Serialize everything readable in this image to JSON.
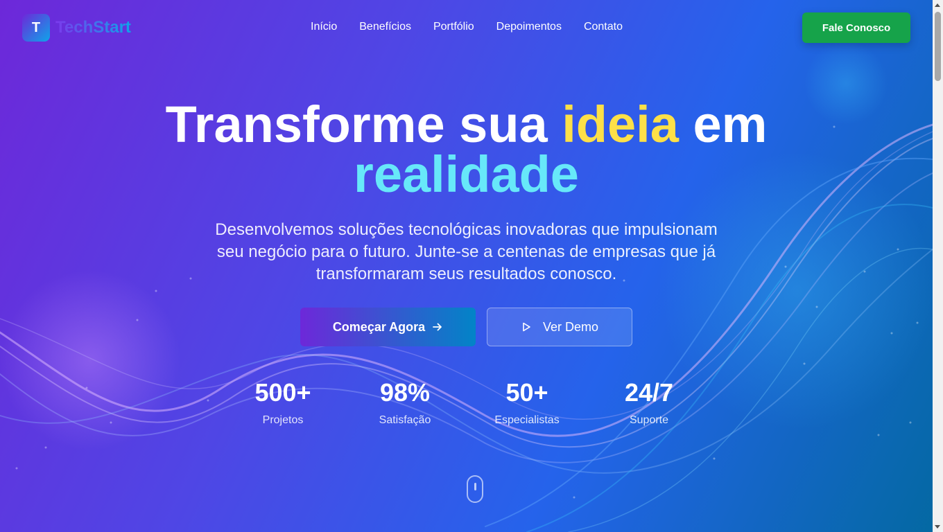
{
  "header": {
    "logo_letter": "T",
    "logo_text": "TechStart",
    "nav": [
      "Início",
      "Benefícios",
      "Portfólio",
      "Depoimentos",
      "Contato"
    ],
    "cta": "Fale Conosco"
  },
  "hero": {
    "title_part1": "Transforme sua ",
    "title_highlight1": "ideia",
    "title_part2": " em",
    "title_highlight2": "realidade",
    "subtitle": "Desenvolvemos soluções tecnológicas inovadoras que impulsionam seu negócio para o futuro. Junte-se a centenas de empresas que já transformaram seus resultados conosco.",
    "primary_button": "Começar Agora",
    "secondary_button": "Ver Demo"
  },
  "stats": [
    {
      "value": "500+",
      "label": "Projetos"
    },
    {
      "value": "98%",
      "label": "Satisfação"
    },
    {
      "value": "50+",
      "label": "Especialistas"
    },
    {
      "value": "24/7",
      "label": "Suporte"
    }
  ],
  "colors": {
    "accent_yellow": "#fde047",
    "accent_cyan": "#67e8f9",
    "cta_green": "#16a34a"
  },
  "icons": {
    "primary_button_icon": "arrow-right-icon",
    "secondary_button_icon": "play-icon",
    "scroll": "mouse-scroll-icon"
  }
}
